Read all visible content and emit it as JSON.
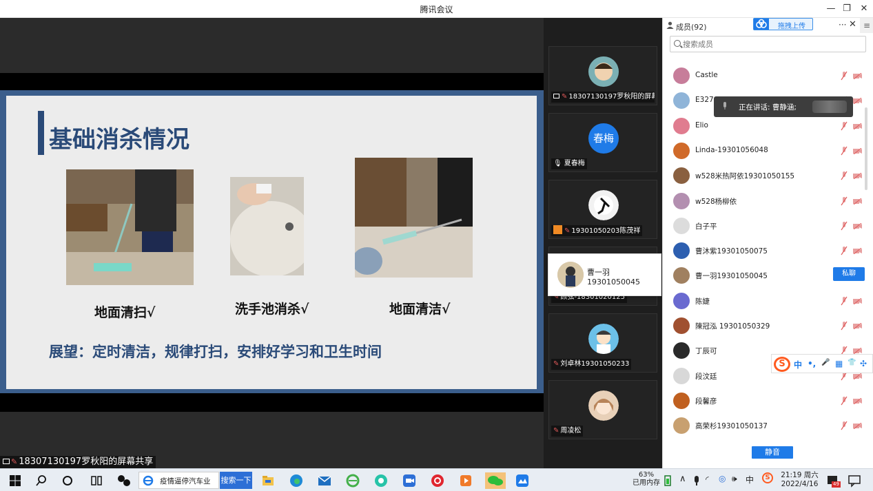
{
  "window": {
    "title": "腾讯会议",
    "minimize": "—",
    "restore": "❐",
    "close": "✕"
  },
  "slide": {
    "title": "基础消杀情况",
    "captions": [
      "地面清扫√",
      "洗手池消杀√",
      "地面清洁√"
    ],
    "outlook": "展望：定时清洁，规律打扫，安排好学习和卫生时间"
  },
  "share_label": "18307130197罗秋阳的屏幕共享",
  "video_tiles": [
    {
      "name": "18307130197罗秋阳的屏幕...",
      "avatar_color": "#6fa3a8"
    },
    {
      "name": "夏春梅",
      "avatar_text": "春梅",
      "avatar_color": "#1f7be8"
    },
    {
      "name": "19301050203陈茂祥",
      "avatar_color": "#e8e8e8"
    },
    {
      "name": "顾弦-18301020125",
      "avatar_color": "#555555"
    },
    {
      "name": "刘卓林19301050233",
      "avatar_color": "#4aa3d8"
    },
    {
      "name": "周凌松",
      "avatar_color": "#d8b89a"
    }
  ],
  "hover_card": {
    "name": "曹一羽19301050045"
  },
  "panel": {
    "title": "成员(92)",
    "upload_label": "拖拽上传",
    "more": "···",
    "close": "✕",
    "menu": "≡",
    "search_placeholder": "搜索成员",
    "speaking": "正在讲话: 曹静涵;",
    "private_chat": "私聊",
    "mute_all": "静音",
    "members": [
      {
        "name": "Castle",
        "avatar_color": "#c77d9a"
      },
      {
        "name": "E327",
        "avatar_color": "#8fb4d8"
      },
      {
        "name": "Elio",
        "avatar_color": "#e07c8f"
      },
      {
        "name": "Linda-19301056048",
        "avatar_color": "#d06a2a"
      },
      {
        "name": "w528米热阿依19301050155",
        "avatar_color": "#8a6040"
      },
      {
        "name": "w528杨柳依",
        "avatar_color": "#b38fb0"
      },
      {
        "name": "白子平",
        "avatar_color": "#dcdcdc"
      },
      {
        "name": "曹沐紫19301050075",
        "avatar_color": "#2d5fb0"
      },
      {
        "name": "曹一羽19301050045",
        "avatar_color": "#a08060"
      },
      {
        "name": "陈婕",
        "avatar_color": "#6a6ad0"
      },
      {
        "name": "陳冠泓 19301050329",
        "avatar_color": "#a05030"
      },
      {
        "name": "丁辰可",
        "avatar_color": "#2a2a2a"
      },
      {
        "name": "段汶廷",
        "avatar_color": "#d8d8d8"
      },
      {
        "name": "段馨彦",
        "avatar_color": "#c06020"
      },
      {
        "name": "高荣杉19301050137",
        "avatar_color": "#c8a070"
      }
    ]
  },
  "ime": {
    "logo": "S",
    "items": [
      "中",
      "•,",
      "🎤",
      "▦",
      "👕",
      "✣"
    ]
  },
  "taskbar": {
    "search_text": "疫情逼停汽车业",
    "search_button": "搜索一下",
    "memory_percent": "63%",
    "memory_label": "已用内存",
    "time": "21:19 周六",
    "date": "2022/4/16",
    "notification_count": "49"
  },
  "colors": {
    "accent": "#1f7be8",
    "slide_blue": "#2a4a78",
    "frame_blue": "#3b5e8c",
    "mute_red": "#e05a5a"
  }
}
